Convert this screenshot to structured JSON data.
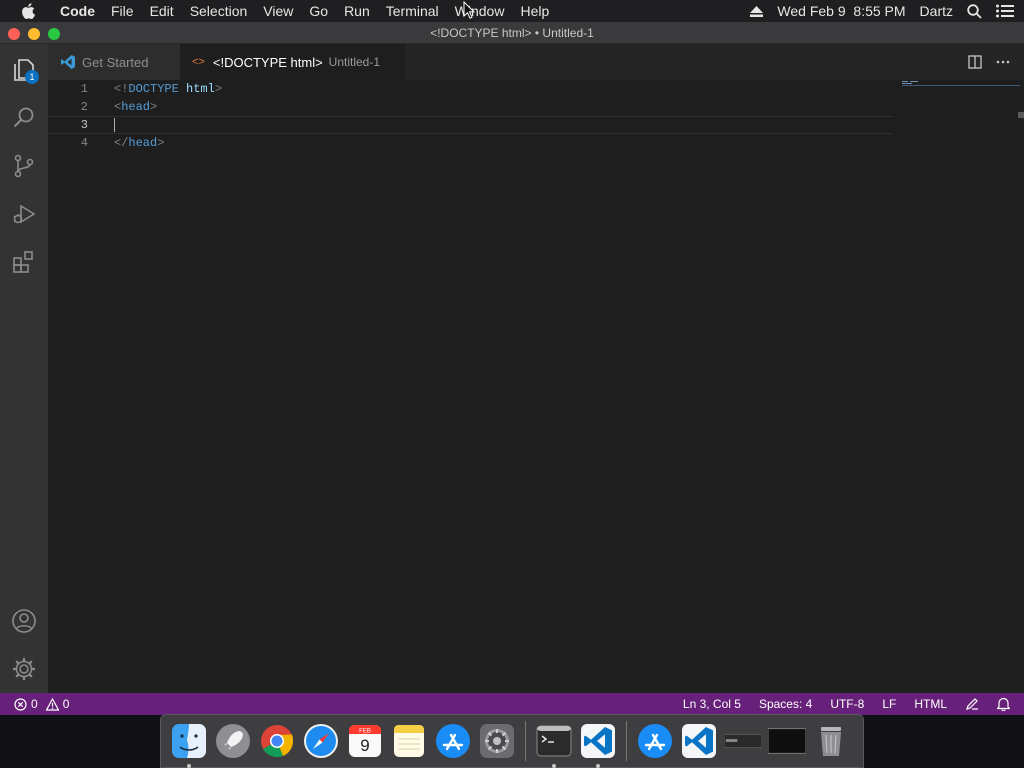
{
  "menubar": {
    "app_name": "Code",
    "items": [
      "File",
      "Edit",
      "Selection",
      "View",
      "Go",
      "Run",
      "Terminal",
      "Window",
      "Help"
    ],
    "datetime": "Wed Feb 9  8:55 PM",
    "user": "Dartz"
  },
  "window": {
    "title": "<!DOCTYPE html> • Untitled-1"
  },
  "activity": {
    "explorer_badge": "1"
  },
  "tabs": {
    "get_started": "Get Started",
    "active_name": "<!DOCTYPE html>",
    "active_sub": "Untitled-1"
  },
  "editor": {
    "line_numbers": [
      "1",
      "2",
      "3",
      "4"
    ],
    "l1_open": "<!",
    "l1_doctype": "DOCTYPE",
    "l1_html": "html",
    "l1_close": ">",
    "l2_open": "<",
    "l2_tag": "head",
    "l2_close": ">",
    "l4_open": "</",
    "l4_tag": "head",
    "l4_close": ">"
  },
  "status": {
    "errors": "0",
    "warnings": "0",
    "position": "Ln 3, Col 5",
    "spaces": "Spaces: 4",
    "encoding": "UTF-8",
    "eol": "LF",
    "language": "HTML"
  },
  "dock": {
    "calendar_month": "FEB",
    "calendar_day": "9"
  },
  "colors": {
    "status_bar": "#68217a",
    "activity_bar": "#333333",
    "editor_bg": "#1e1e1e",
    "tag": "#569cd6"
  }
}
